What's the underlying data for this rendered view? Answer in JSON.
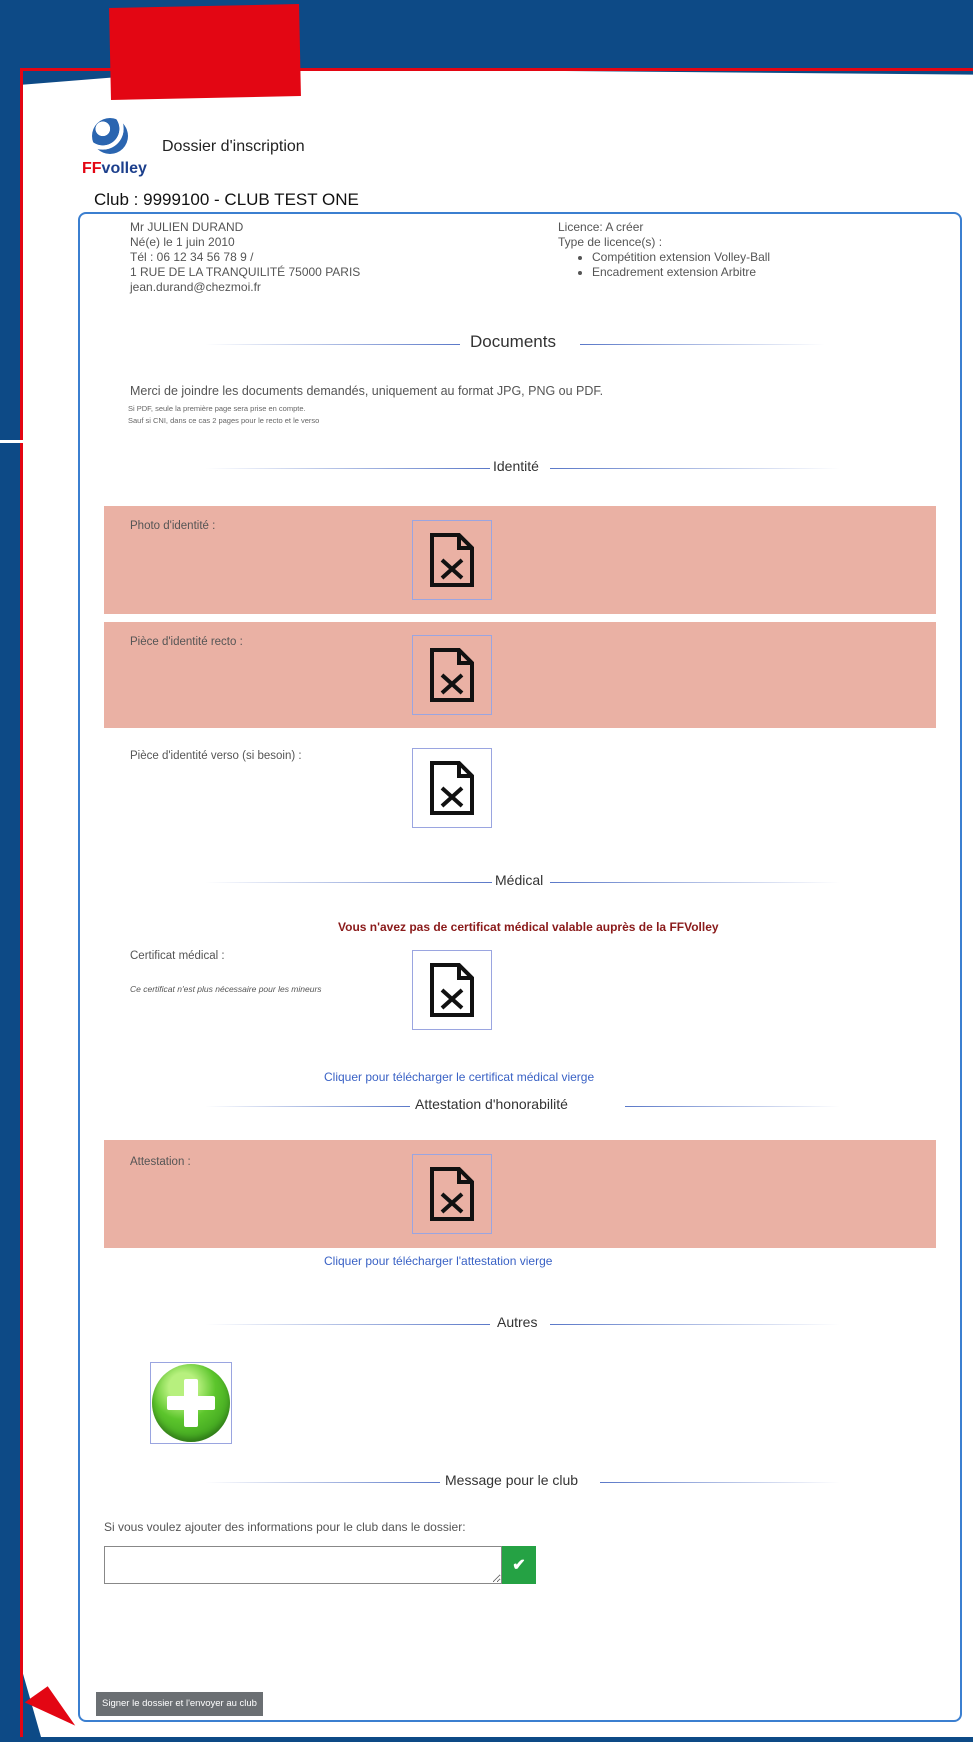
{
  "header": {
    "logo_prefix": "FF",
    "logo_suffix": "volley",
    "title": "Dossier d'inscription",
    "club": "Club : 9999100 - CLUB TEST ONE"
  },
  "person": {
    "name": "Mr JULIEN DURAND",
    "birth": "Né(e) le 1 juin 2010",
    "phone": "Tél : 06 12 34 56 78 9 /",
    "address": "1 RUE DE LA TRANQUILITÉ 75000 PARIS",
    "email": "jean.durand@chezmoi.fr"
  },
  "licence": {
    "status": "Licence: A créer",
    "types_label": "Type de licence(s) :",
    "types": [
      "Compétition extension Volley-Ball",
      "Encadrement extension Arbitre"
    ]
  },
  "documents": {
    "heading": "Documents",
    "intro": "Merci de joindre les documents demandés, uniquement au format JPG, PNG ou PDF.",
    "note1": "Si PDF, seule la première page sera prise en compte.",
    "note2": "Sauf si CNI, dans ce cas 2 pages pour le recto et le verso"
  },
  "identity": {
    "heading": "Identité",
    "photo_label": "Photo d'identité :",
    "recto_label": "Pièce d'identité recto :",
    "verso_label": "Pièce d'identité verso (si besoin) :"
  },
  "medical": {
    "heading": "Médical",
    "warning": "Vous n'avez pas de certificat médical valable auprès de la FFVolley",
    "label": "Certificat médical :",
    "sublabel": "Ce certificat n'est plus nécessaire pour les mineurs",
    "download_link": "Cliquer pour télécharger le certificat médical vierge"
  },
  "honor": {
    "heading": "Attestation d'honorabilité",
    "label": "Attestation :",
    "download_link": "Cliquer pour télécharger l'attestation vierge"
  },
  "others": {
    "heading": "Autres"
  },
  "message": {
    "heading": "Message pour le club",
    "label": "Si vous voulez ajouter des informations pour le club dans le dossier:",
    "value": "",
    "confirm_icon": "check-icon"
  },
  "submit_label": "Signer le dossier et l'envoyer au club",
  "colors": {
    "background": "#0d4a86",
    "accent_red": "#e30613",
    "missing_row": "#eab1a4",
    "link": "#3a62c5",
    "confirm": "#25a244"
  }
}
